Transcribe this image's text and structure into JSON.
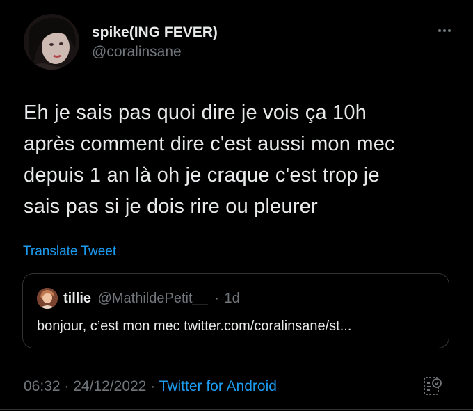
{
  "tweet": {
    "author": {
      "display_name": "spike(ING FEVER)",
      "handle": "@coralinsane"
    },
    "text_lines": [
      "Eh je sais pas quoi dire je vois ça 10h",
      "après comment dire c'est aussi mon mec",
      "depuis 1 an là oh je craque c'est trop je",
      "sais pas si je dois rire ou pleurer"
    ],
    "translate_label": "Translate Tweet",
    "quote": {
      "name": "tillie",
      "handle": "@MathildePetit__",
      "separator": "·",
      "time": "1d",
      "text": "bonjour, c’est mon mec twitter.com/coralinsane/st..."
    },
    "footer": {
      "time": "06:32",
      "separator": "·",
      "date": "24/12/2022",
      "separator2": "·",
      "source": "Twitter for Android"
    },
    "icons": {
      "more": "more-horizontal-icon",
      "analytics": "analytics-icon"
    },
    "colors": {
      "background": "#000000",
      "text": "#e7e9ea",
      "muted": "#71767b",
      "link": "#1d9bf0",
      "border": "#2f3336"
    }
  }
}
